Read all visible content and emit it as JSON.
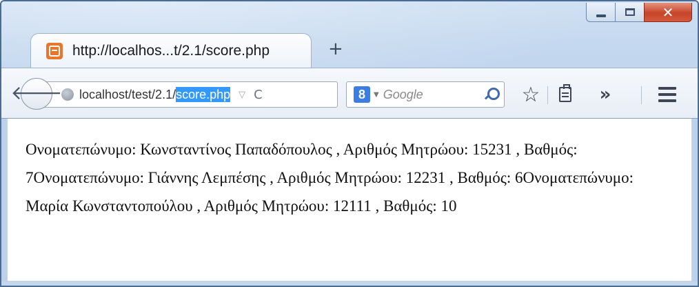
{
  "tab": {
    "title": "http://localhos...t/2.1/score.php"
  },
  "toolbar": {
    "new_tab_label": "+",
    "url_prefix": "localhost/test/2.1/",
    "url_selected": "score.php",
    "search_placeholder": "Google",
    "search_engine_letter": "8",
    "overflow_label": "»"
  },
  "icons": {
    "favicon": "xampp-favicon-icon",
    "back": "back-arrow-icon",
    "site_identity": "globe-icon",
    "dropdown": "url-dropdown-icon",
    "reload": "reload-icon",
    "search_engine": "google-search-engine-icon",
    "search": "search-icon",
    "bookmark": "star-icon",
    "reading_list": "reading-list-icon",
    "overflow": "overflow-chevron-icon",
    "menu": "hamburger-menu-icon",
    "minimize": "minimize-icon",
    "maximize": "maximize-icon",
    "close": "close-icon"
  },
  "page": {
    "text": "Ονοματεπώνυμο: Κωνσταντίνος Παπαδόπουλος , Αριθμός Μητρώου: 15231 , Βαθμός: 7Ονοματεπώνυμο: Γιάννης Λεμπέσης , Αριθμός Μητρώου: 12231 , Βαθμός: 6Ονοματεπώνυμο: Μαρία Κωνσταντοπούλου , Αριθμός Μητρώου: 12111 , Βαθμός: 10"
  },
  "colors": {
    "selection": "#3399ff",
    "close_button": "#c8442a",
    "favicon": "#e8762c"
  }
}
